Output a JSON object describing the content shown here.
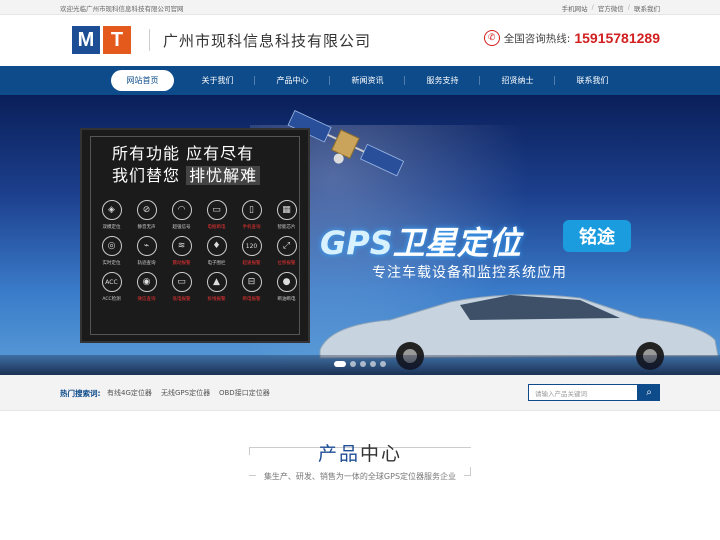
{
  "topbar": {
    "welcome": "欢迎光临广州市现科信息科技有限公司官网",
    "links": [
      "手机网站",
      "官方微信",
      "联系我们"
    ],
    "sep": "/"
  },
  "header": {
    "logo_m": "M",
    "logo_t": "T",
    "company": "广州市现科信息科技有限公司",
    "hotline_label": "全国咨询热线:",
    "hotline_number": "15915781289"
  },
  "nav": {
    "items": [
      "网站首页",
      "关于我们",
      "产品中心",
      "新闻资讯",
      "服务支持",
      "招贤纳士",
      "联系我们"
    ]
  },
  "banner": {
    "panel_line1a": "所有功能",
    "panel_line1b": "应有尽有",
    "panel_line2a": "我们替您",
    "panel_line2b": "排忧解难",
    "features": [
      {
        "icon": "◈",
        "label": "双模定位",
        "red": false
      },
      {
        "icon": "⊘",
        "label": "静音无声",
        "red": false
      },
      {
        "icon": "◠",
        "label": "超强信号",
        "red": false
      },
      {
        "icon": "▭",
        "label": "电瓶断电",
        "red": true
      },
      {
        "icon": "▯",
        "label": "手机查询",
        "red": true
      },
      {
        "icon": "▦",
        "label": "智能芯片",
        "red": false
      },
      {
        "icon": "◎",
        "label": "实时定位",
        "red": false
      },
      {
        "icon": "⌁",
        "label": "轨迹查询",
        "red": false
      },
      {
        "icon": "≋",
        "label": "震动报警",
        "red": true
      },
      {
        "icon": "♦",
        "label": "电子围栏",
        "red": false
      },
      {
        "icon": "120",
        "label": "超速报警",
        "red": true
      },
      {
        "icon": "⤢",
        "label": "位移报警",
        "red": true
      },
      {
        "icon": "ACC",
        "label": "ACC检测",
        "red": false
      },
      {
        "icon": "◉",
        "label": "微信查询",
        "red": true
      },
      {
        "icon": "▭",
        "label": "低电报警",
        "red": true
      },
      {
        "icon": "▲",
        "label": "拆线报警",
        "red": true
      },
      {
        "icon": "⊟",
        "label": "断电报警",
        "red": true
      },
      {
        "icon": "●",
        "label": "断油断电",
        "red": false
      }
    ],
    "gps_text": "GPS",
    "gps_title_rest": "卫星定位",
    "brand": "铭途",
    "tagline": "专注车载设备和监控系统应用",
    "slide_count": 5,
    "active_slide": 0
  },
  "search": {
    "hot_label": "热门搜索词:",
    "keywords": [
      "有线4G定位器",
      "无线GPS定位器",
      "OBD接口定位器"
    ],
    "placeholder": "请输入产品关键词"
  },
  "section": {
    "title_a": "产品",
    "title_b": "中心",
    "subtitle": "集生产、研发、销售为一体的全球GPS定位器服务企业"
  },
  "colors": {
    "nav_bg": "#0d4b8b",
    "hotline": "#d21f1f",
    "logo_blue": "#1d4d95",
    "logo_orange": "#e45a1c"
  }
}
